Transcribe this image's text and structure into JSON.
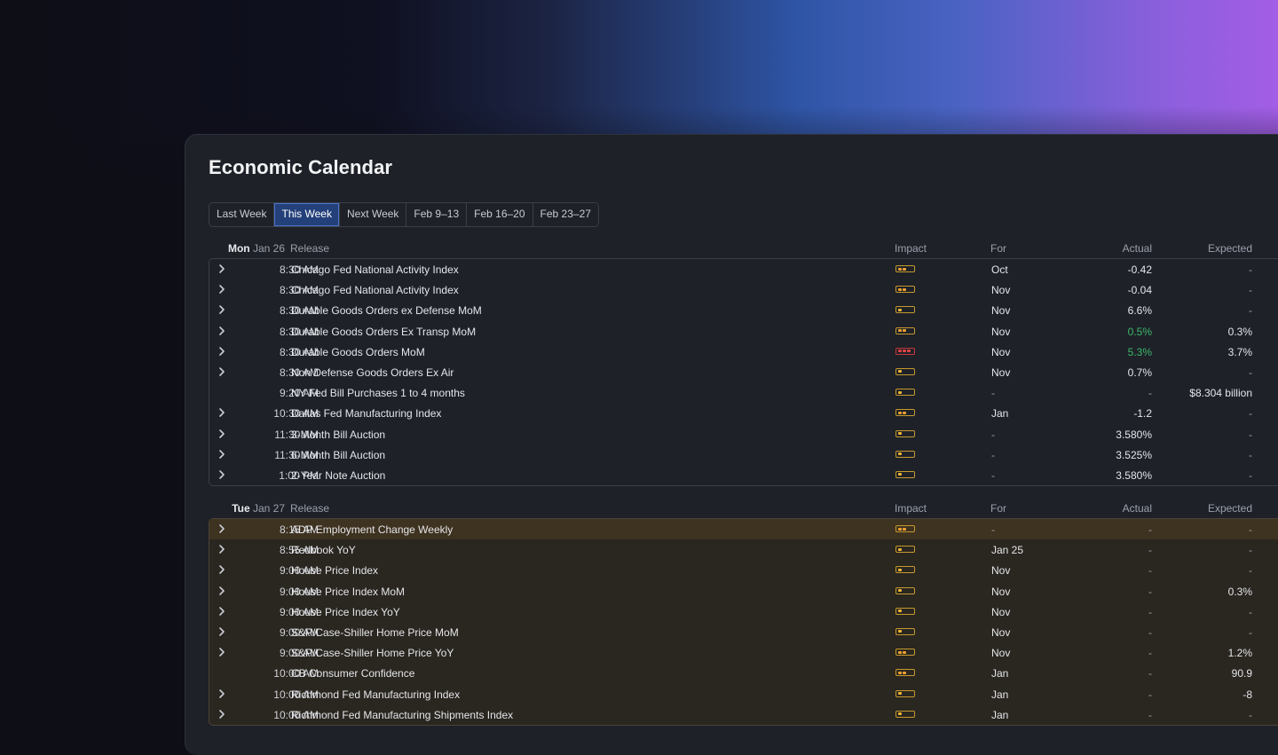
{
  "title": "Economic Calendar",
  "tabs": [
    "Last Week",
    "This Week",
    "Next Week",
    "Feb 9–13",
    "Feb 16–20",
    "Feb 23–27"
  ],
  "active_tab": "This Week",
  "columns": {
    "release": "Release",
    "impact": "Impact",
    "for": "For",
    "actual": "Actual",
    "expected": "Expected"
  },
  "days": [
    {
      "dayname": "Mon",
      "date": "Jan 26",
      "rows": [
        {
          "time": "8:30 AM",
          "release": "Chicago Fed National Activity Index",
          "impact": 2,
          "for": "Oct",
          "actual": "-0.42",
          "expected": "-",
          "expandable": true,
          "actual_color": "default"
        },
        {
          "time": "8:30 AM",
          "release": "Chicago Fed National Activity Index",
          "impact": 2,
          "for": "Nov",
          "actual": "-0.04",
          "expected": "-",
          "expandable": true,
          "actual_color": "default"
        },
        {
          "time": "8:30 AM",
          "release": "Durable Goods Orders ex Defense MoM",
          "impact": 1,
          "for": "Nov",
          "actual": "6.6%",
          "expected": "-",
          "expandable": true,
          "actual_color": "default"
        },
        {
          "time": "8:30 AM",
          "release": "Durable Goods Orders Ex Transp MoM",
          "impact": 2,
          "for": "Nov",
          "actual": "0.5%",
          "expected": "0.3%",
          "expandable": true,
          "actual_color": "green"
        },
        {
          "time": "8:30 AM",
          "release": "Durable Goods Orders MoM",
          "impact": 3,
          "for": "Nov",
          "actual": "5.3%",
          "expected": "3.7%",
          "expandable": true,
          "actual_color": "green"
        },
        {
          "time": "8:30 AM",
          "release": "Non Defense Goods Orders Ex Air",
          "impact": 1,
          "for": "Nov",
          "actual": "0.7%",
          "expected": "-",
          "expandable": true,
          "actual_color": "default"
        },
        {
          "time": "9:20 AM",
          "release": "NY Fed Bill Purchases 1 to 4 months",
          "impact": 1,
          "for": "-",
          "actual": "-",
          "expected": "$8.304 billion",
          "expandable": false,
          "actual_color": "default"
        },
        {
          "time": "10:30 AM",
          "release": "Dallas Fed Manufacturing Index",
          "impact": 2,
          "for": "Jan",
          "actual": "-1.2",
          "expected": "-",
          "expandable": true,
          "actual_color": "default"
        },
        {
          "time": "11:30 AM",
          "release": "3-Month Bill Auction",
          "impact": 1,
          "for": "-",
          "actual": "3.580%",
          "expected": "-",
          "expandable": true,
          "actual_color": "default"
        },
        {
          "time": "11:30 AM",
          "release": "6-Month Bill Auction",
          "impact": 1,
          "for": "-",
          "actual": "3.525%",
          "expected": "-",
          "expandable": true,
          "actual_color": "default"
        },
        {
          "time": "1:00 PM",
          "release": "2-Year Note Auction",
          "impact": 1,
          "for": "-",
          "actual": "3.580%",
          "expected": "-",
          "expandable": true,
          "actual_color": "default"
        }
      ]
    },
    {
      "dayname": "Tue",
      "date": "Jan 27",
      "rows": [
        {
          "time": "8:15 AM",
          "release": "ADP Employment Change Weekly",
          "impact": 2,
          "for": "-",
          "actual": "-",
          "expected": "-",
          "expandable": true,
          "actual_color": "default"
        },
        {
          "time": "8:55 AM",
          "release": "Redbook YoY",
          "impact": 1,
          "for": "Jan 25",
          "actual": "-",
          "expected": "-",
          "expandable": true,
          "actual_color": "default"
        },
        {
          "time": "9:00 AM",
          "release": "House Price Index",
          "impact": 1,
          "for": "Nov",
          "actual": "-",
          "expected": "-",
          "expandable": true,
          "actual_color": "default"
        },
        {
          "time": "9:00 AM",
          "release": "House Price Index MoM",
          "impact": 1,
          "for": "Nov",
          "actual": "-",
          "expected": "0.3%",
          "expandable": true,
          "actual_color": "default"
        },
        {
          "time": "9:00 AM",
          "release": "House Price Index YoY",
          "impact": 1,
          "for": "Nov",
          "actual": "-",
          "expected": "-",
          "expandable": true,
          "actual_color": "default"
        },
        {
          "time": "9:00 AM",
          "release": "S&P/Case-Shiller Home Price MoM",
          "impact": 1,
          "for": "Nov",
          "actual": "-",
          "expected": "-",
          "expandable": true,
          "actual_color": "default"
        },
        {
          "time": "9:00 AM",
          "release": "S&P/Case-Shiller Home Price YoY",
          "impact": 2,
          "for": "Nov",
          "actual": "-",
          "expected": "1.2%",
          "expandable": true,
          "actual_color": "default"
        },
        {
          "time": "10:00 AM",
          "release": "CB Consumer Confidence",
          "impact": 2,
          "for": "Jan",
          "actual": "-",
          "expected": "90.9",
          "expandable": false,
          "actual_color": "default"
        },
        {
          "time": "10:00 AM",
          "release": "Richmond Fed Manufacturing Index",
          "impact": 1,
          "for": "Jan",
          "actual": "-",
          "expected": "-8",
          "expandable": true,
          "actual_color": "default"
        },
        {
          "time": "10:00 AM",
          "release": "Richmond Fed Manufacturing Shipments Index",
          "impact": 1,
          "for": "Jan",
          "actual": "-",
          "expected": "-",
          "expandable": true,
          "actual_color": "default"
        }
      ]
    }
  ],
  "colors": {
    "accent_tab": "#24407a",
    "impact_low": "#f0b533",
    "impact_high": "#e14246",
    "actual_positive": "#3bb86a",
    "highlight_row": "#3e3220"
  },
  "icons": {
    "row_expand": "chevron-right-icon",
    "impact": "impact-meter-icon"
  }
}
